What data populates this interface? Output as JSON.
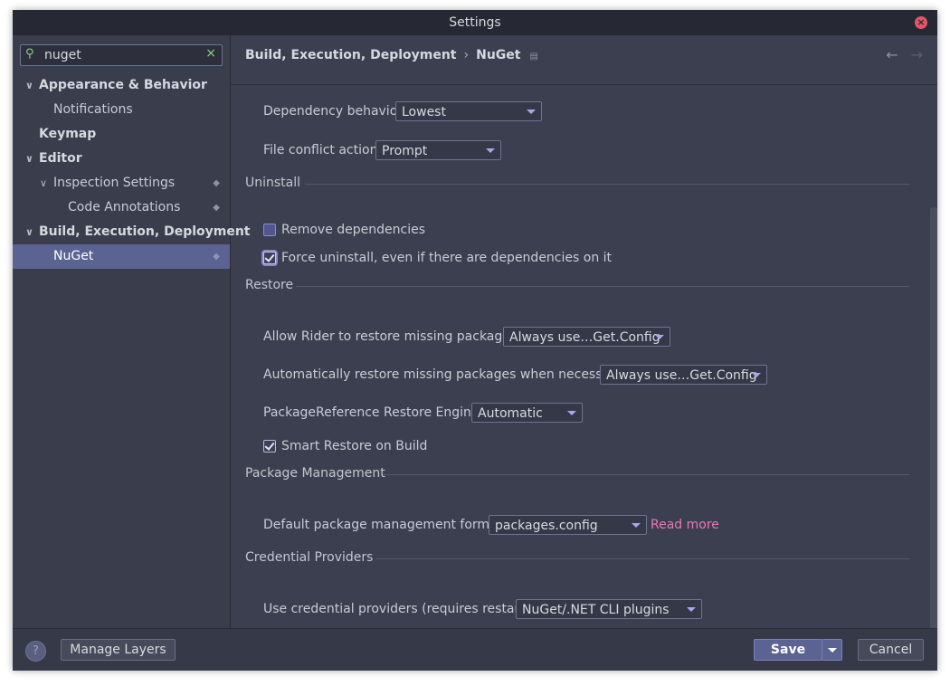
{
  "window": {
    "title": "Settings"
  },
  "sidebar": {
    "search_value": "nuget",
    "items": [
      {
        "label": "Appearance & Behavior"
      },
      {
        "label": "Notifications"
      },
      {
        "label": "Keymap"
      },
      {
        "label": "Editor"
      },
      {
        "label": "Inspection Settings"
      },
      {
        "label": "Code Annotations"
      },
      {
        "label": "Build, Execution, Deployment"
      },
      {
        "label": "NuGet"
      }
    ]
  },
  "header": {
    "breadcrumb_parent": "Build, Execution, Deployment",
    "breadcrumb_separator": "›",
    "breadcrumb_current": "NuGet"
  },
  "settings": {
    "dependency_behavior": {
      "label": "Dependency behavior",
      "value": "Lowest"
    },
    "file_conflict_action": {
      "label": "File conflict action",
      "value": "Prompt"
    },
    "uninstall": {
      "title": "Uninstall",
      "remove_dependencies": {
        "label": "Remove dependencies",
        "checked": false
      },
      "force_uninstall": {
        "label": "Force uninstall, even if there are dependencies on it",
        "checked": true
      }
    },
    "restore": {
      "title": "Restore",
      "allow_rider": {
        "label": "Allow Rider to restore missing packages",
        "value": "Always use…Get.Config"
      },
      "auto_restore": {
        "label": "Automatically restore missing packages when necessary",
        "value": "Always use…Get.Config"
      },
      "engine": {
        "label": "PackageReference Restore Engine",
        "value": "Automatic"
      },
      "smart_restore": {
        "label": "Smart Restore on Build",
        "checked": true
      }
    },
    "package_management": {
      "title": "Package Management",
      "default_format": {
        "label": "Default package management format",
        "value": "packages.config"
      },
      "read_more": "Read more"
    },
    "credential_providers": {
      "title": "Credential Providers",
      "use_providers": {
        "label": "Use credential providers (requires restart)",
        "value": "NuGet/.NET CLI plugins"
      }
    }
  },
  "footer": {
    "help": "?",
    "manage_layers": "Manage Layers",
    "save": "Save",
    "cancel": "Cancel"
  },
  "colors": {
    "selection": "#5b6393",
    "link": "#e57ab8",
    "background": "#3c3f4f"
  }
}
